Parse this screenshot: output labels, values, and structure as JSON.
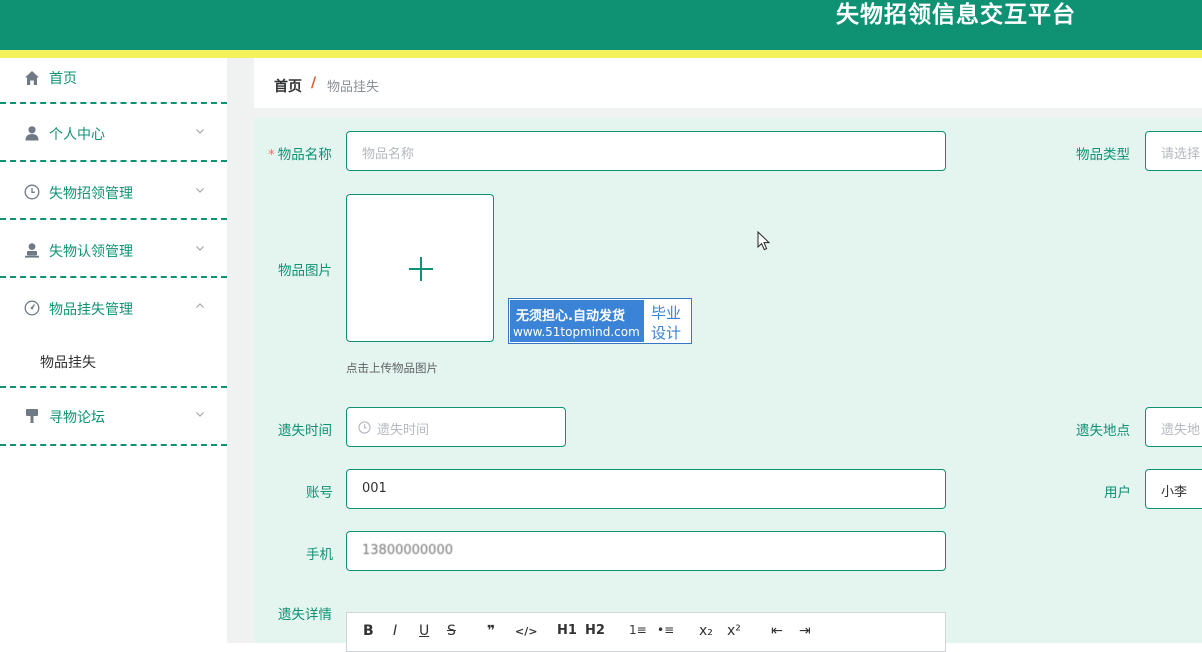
{
  "header": {
    "title": "失物招领信息交互平台"
  },
  "sidebar": {
    "items": [
      {
        "label": "首页",
        "icon": "home-icon"
      },
      {
        "label": "个人中心",
        "icon": "user-icon"
      },
      {
        "label": "失物招领管理",
        "icon": "clock-icon"
      },
      {
        "label": "失物认领管理",
        "icon": "person-stamp-icon"
      },
      {
        "label": "物品挂失管理",
        "icon": "gauge-icon"
      },
      {
        "label": "寻物论坛",
        "icon": "brush-icon"
      }
    ],
    "sub_items": [
      {
        "label": "物品挂失"
      }
    ]
  },
  "breadcrumb": {
    "home": "首页",
    "separator": "/",
    "current": "物品挂失"
  },
  "form": {
    "item_name": {
      "label": "物品名称",
      "placeholder": "物品名称",
      "required_mark": "*"
    },
    "item_type": {
      "label": "物品类型",
      "placeholder": "请选择"
    },
    "item_image": {
      "label": "物品图片",
      "tip": "点击上传物品图片",
      "plus": "+"
    },
    "lost_time": {
      "label": "遗失时间",
      "placeholder": "遗失时间"
    },
    "lost_place": {
      "label": "遗失地点",
      "placeholder": "遗失地"
    },
    "account": {
      "label": "账号",
      "value": "001"
    },
    "user": {
      "label": "用户",
      "value": "小李"
    },
    "phone": {
      "label": "手机",
      "value": "13800000000"
    },
    "details": {
      "label": "遗失详情"
    }
  },
  "editor_toolbar": [
    "B",
    "I",
    "U",
    "S",
    "❞",
    "</>",
    "H1",
    "H2",
    "1≡",
    "•≡",
    "x₂",
    "x²",
    "⇤",
    "⇥"
  ],
  "watermark": {
    "line1": "无须担心.自动发货",
    "line2": "www.51topmind.com",
    "right1": "毕业",
    "right2": "设计"
  },
  "colors": {
    "primary": "#0f9274",
    "accent_yellow": "#f4f25a",
    "form_bg": "#e4f4ef"
  }
}
